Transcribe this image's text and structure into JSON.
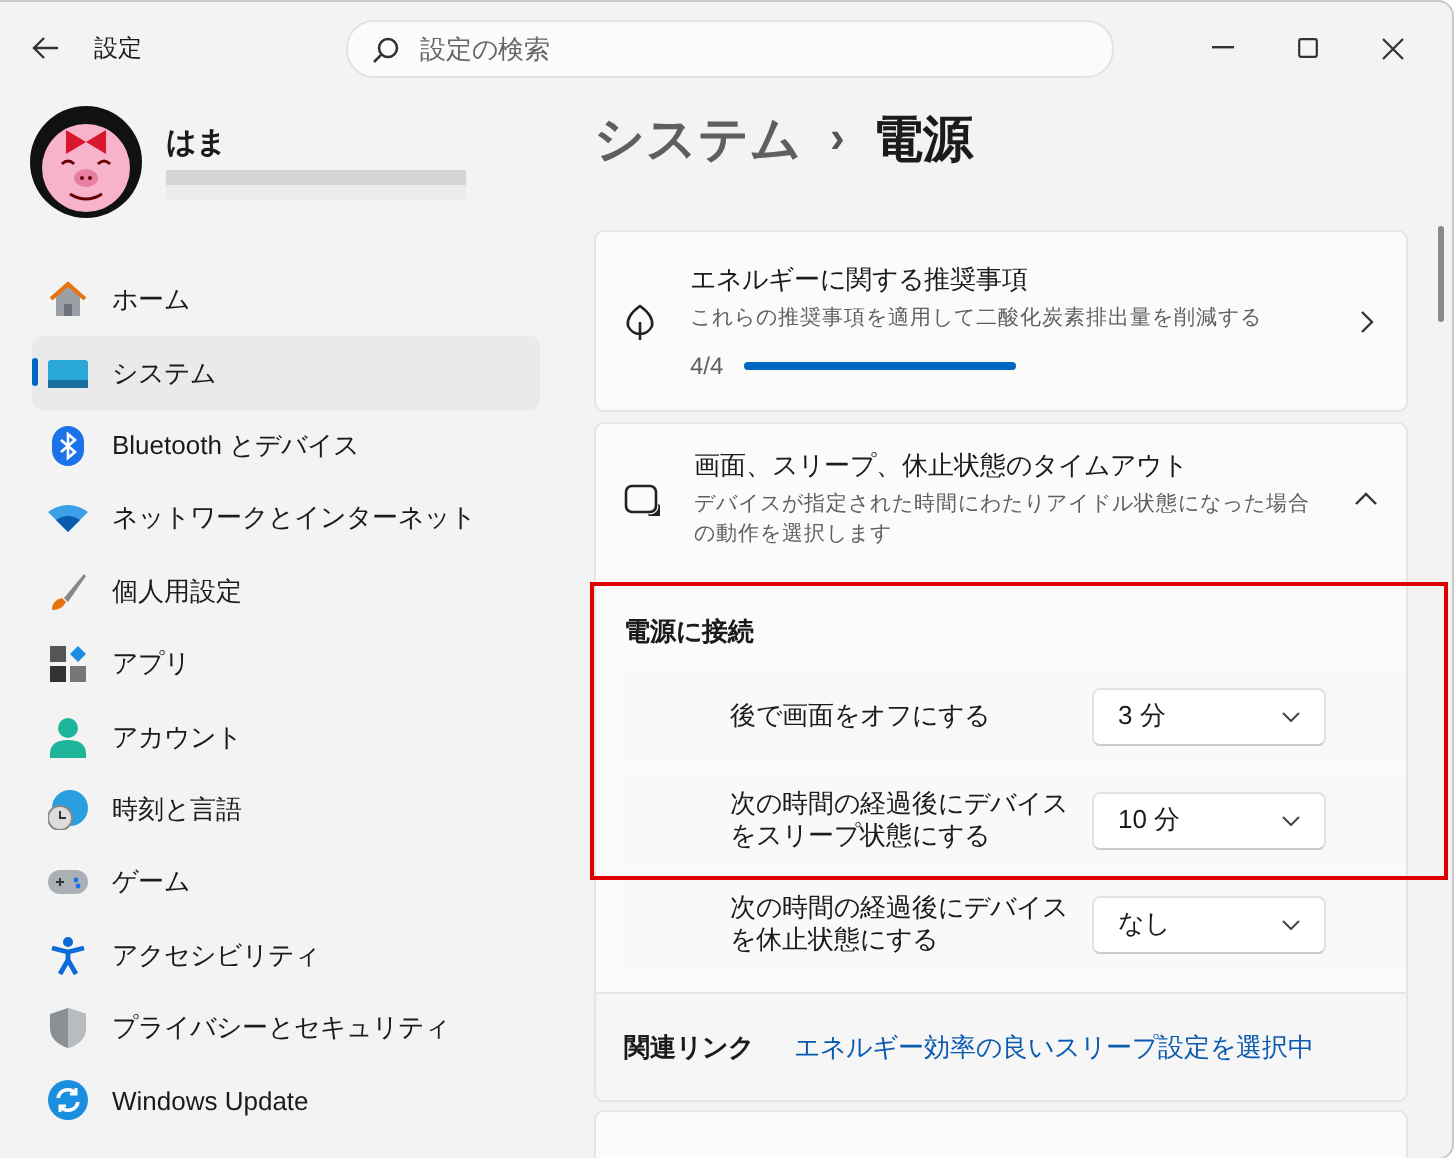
{
  "window": {
    "title": "設定"
  },
  "search": {
    "placeholder": "設定の検索"
  },
  "user": {
    "name": "はま"
  },
  "nav": [
    {
      "label": "ホーム",
      "selected": false
    },
    {
      "label": "システム",
      "selected": true
    },
    {
      "label": "Bluetooth とデバイス",
      "selected": false
    },
    {
      "label": "ネットワークとインターネット",
      "selected": false
    },
    {
      "label": "個人用設定",
      "selected": false
    },
    {
      "label": "アプリ",
      "selected": false
    },
    {
      "label": "アカウント",
      "selected": false
    },
    {
      "label": "時刻と言語",
      "selected": false
    },
    {
      "label": "ゲーム",
      "selected": false
    },
    {
      "label": "アクセシビリティ",
      "selected": false
    },
    {
      "label": "プライバシーとセキュリティ",
      "selected": false
    },
    {
      "label": "Windows Update",
      "selected": false
    }
  ],
  "breadcrumb": {
    "parent": "システム",
    "separator": "›",
    "current": "電源"
  },
  "recommendations": {
    "title": "エネルギーに関する推奨事項",
    "description": "これらの推奨事項を適用して二酸化炭素排出量を削減する",
    "progress": "4/4",
    "level": 1
  },
  "timeouts": {
    "title": "画面、スリープ、休止状態のタイムアウト",
    "description": "デバイスが指定された時間にわたりアイドル状態になった場合の動作を選択します",
    "expanded": true,
    "section": "電源に接続",
    "settings": [
      {
        "label": "後で画面をオフにする",
        "value": "3 分",
        "highlighted": true
      },
      {
        "label": "次の時間の経過後にデバイスをスリープ状態にする",
        "value": "10 分",
        "highlighted": true
      },
      {
        "label": "次の時間の経過後にデバイスを休止状態にする",
        "value": "なし",
        "highlighted": false
      }
    ]
  },
  "related": {
    "label": "関連リンク",
    "link": "エネルギー効率の良いスリープ設定を選択中"
  }
}
